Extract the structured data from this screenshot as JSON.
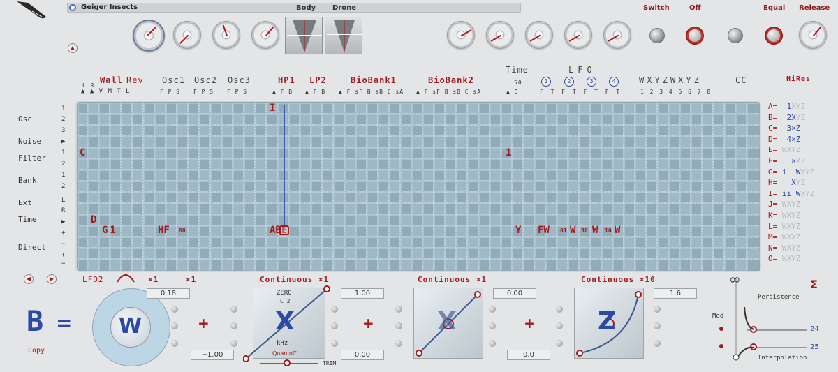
{
  "window": {
    "title": "Geiger Insects"
  },
  "top": {
    "body_label": "Body",
    "drone_label": "Drone",
    "switch_label": "Switch",
    "off_label": "Off",
    "equal_label": "Equal",
    "release_label": "Release"
  },
  "grid": {
    "headers": {
      "wall": "Wall",
      "rev": "Rev",
      "osc1": "Osc1",
      "osc2": "Osc2",
      "osc3": "Osc3",
      "hp1": "HP1",
      "lp2": "LP2",
      "biobank1": "BioBank1",
      "biobank2": "BioBank2",
      "time": "Time",
      "lfo": "LFO",
      "wxyz": "WXYZWXYZ",
      "cc": "CC",
      "hires": "HiRes"
    },
    "subheaders": {
      "lr": "L R",
      "avmtl": "▲ ▲ V M T L",
      "osc1": "F P S",
      "osc2": "F P S",
      "osc3": "F P S",
      "hp1": "▲ F B",
      "lp2": "▲ F B",
      "bb1": "▲ F sF B sB C sA",
      "bb2": "▲ F sF B sB C sA",
      "time": "▲ D",
      "time_val": "50",
      "lfo": "F T F T F T F T",
      "nums": "1 2 3 4 5 6 7 8",
      "lfo_btns": [
        "1",
        "2",
        "3",
        "4"
      ]
    },
    "row_labels": [
      "Osc",
      "Noise",
      "Filter",
      "Bank",
      "Ext",
      "Time",
      "Direct"
    ],
    "row_numbers": [
      "1",
      "2",
      "3",
      "▶",
      "1",
      "2",
      "1",
      "2",
      "L",
      "R",
      "▶",
      "+",
      "−",
      "+",
      "−",
      "×"
    ],
    "marks": {
      "c": "C",
      "i": "I",
      "d": "D",
      "one": "1",
      "g1": "G1",
      "hf": "HF",
      "hf_sub": "88",
      "abe": "ABE",
      "y": "Y",
      "fw": "FW",
      "w1": "W",
      "w1sub": "01",
      "w2": "W",
      "w2sub": "30",
      "w3": "W",
      "w3sub": "10",
      "w4": "W"
    },
    "hires_rows": [
      {
        "k": "A=",
        "v": "  1",
        "g": "XYZ"
      },
      {
        "k": "B=",
        "v": "  2X",
        "g": "YZ"
      },
      {
        "k": "C=",
        "v": "  3",
        "g": "×Z"
      },
      {
        "k": "D=",
        "v": "  4",
        "g": "×Z"
      },
      {
        "k": "E=",
        "v": "",
        "g": " WXYZ"
      },
      {
        "k": "F=",
        "v": "   ×",
        "g": "YZ"
      },
      {
        "k": "G=",
        "v": " i  W",
        "g": "XYZ"
      },
      {
        "k": "H=",
        "v": "   X",
        "g": "YZ"
      },
      {
        "k": "I=",
        "v": " ii W",
        "g": "XYZ"
      },
      {
        "k": "J=",
        "v": "",
        "g": " WXYZ"
      },
      {
        "k": "K=",
        "v": "",
        "g": " WXYZ"
      },
      {
        "k": "L=",
        "v": "",
        "g": " WXYZ"
      },
      {
        "k": "M=",
        "v": "",
        "g": " WXYZ"
      },
      {
        "k": "N=",
        "v": "",
        "g": " WXYZ"
      },
      {
        "k": "O=",
        "v": "",
        "g": " WXYZ"
      }
    ]
  },
  "bottom": {
    "lfo2": "LFO2",
    "x1a": "×1",
    "x1b": "×1",
    "big_letter": "B",
    "equals": "=",
    "copy": "Copy",
    "w": "W",
    "cont1": "Continuous ×1",
    "cont2": "Continuous ×1",
    "cont3": "Continuous ×10",
    "v_018": "0.18",
    "v_m100": "−1.00",
    "v_100": "1.00",
    "v_000a": "0.00",
    "v_000b": "0.00",
    "v_00": "0.0",
    "v_16": "1.6",
    "zero": "ZERO",
    "c2": "C 2",
    "khz": "kHz",
    "quan": "Quan off",
    "trim": "TRIM",
    "x": "X",
    "z": "Z",
    "plus": "+",
    "mod": "Mod",
    "persistence": "Persistence",
    "interpolation": "Interpolation",
    "infinity": "∞",
    "sigma": "Σ",
    "v24": "24",
    "v25": "25"
  }
}
